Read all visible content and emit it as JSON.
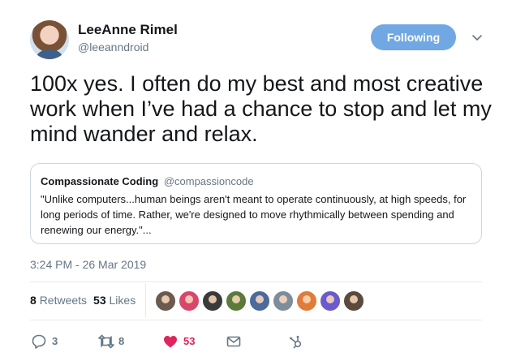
{
  "user": {
    "display_name": "LeeAnne Rimel",
    "handle": "@leeanndroid",
    "follow_label": "Following"
  },
  "tweet": {
    "text": "100x yes. I often do my best and most creative work when I’ve had a chance to stop and let my mind wander and relax.",
    "timestamp": "3:24 PM - 26 Mar 2019"
  },
  "quote": {
    "name": "Compassionate Coding",
    "handle": "@compassioncode",
    "text": "\"Unlike computers...human beings aren't meant to operate continuously, at high speeds, for long periods of time. Rather, we're designed to move rhythmically between spending and renewing our energy.\"..."
  },
  "stats": {
    "retweets_count": "8",
    "retweets_label": "Retweets",
    "likes_count": "53",
    "likes_label": "Likes"
  },
  "likers": [
    {
      "color": "#6b5a4e"
    },
    {
      "color": "#d6476b"
    },
    {
      "color": "#3a3a3a"
    },
    {
      "color": "#5b7a3c"
    },
    {
      "color": "#4c6a9a"
    },
    {
      "color": "#7d8d99"
    },
    {
      "color": "#e07b39"
    },
    {
      "color": "#6a5acd"
    },
    {
      "color": "#5c4a3c"
    }
  ],
  "actions": {
    "reply_count": "3",
    "retweet_count": "8",
    "like_count": "53"
  },
  "colors": {
    "accent": "#71a8e3",
    "like": "#e0245e",
    "muted": "#657786",
    "border": "#e6ecf0"
  }
}
